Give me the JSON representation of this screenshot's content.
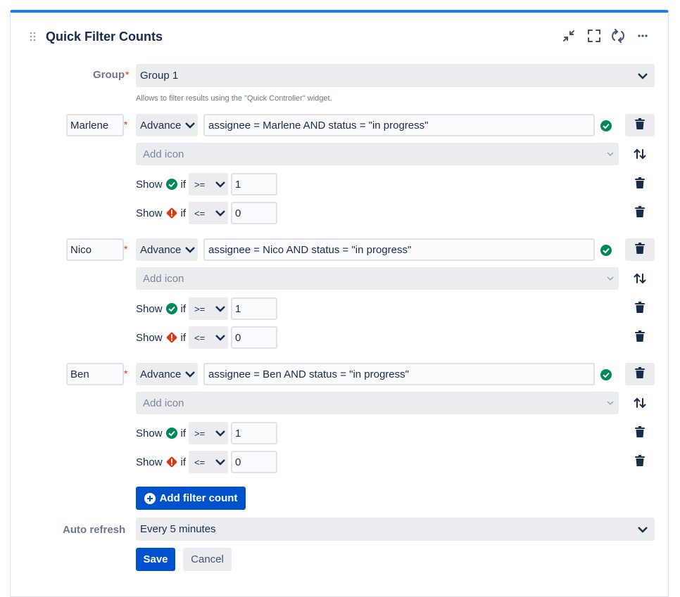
{
  "widget": {
    "title": "Quick Filter Counts"
  },
  "group": {
    "label": "Group",
    "required_mark": "*",
    "value": "Group 1",
    "help": "Allows to filter results using the \"Quick Controller\" widget."
  },
  "filters": [
    {
      "name": "Marlene",
      "mode": "Advance",
      "jql": "assignee = Marlene  AND status = \"in progress\"",
      "icon_placeholder": "Add icon",
      "rules": [
        {
          "show": "Show",
          "if": "if",
          "icon": "success-icon",
          "operator": ">=",
          "value": "1"
        },
        {
          "show": "Show",
          "if": "if",
          "icon": "error-icon",
          "operator": "<=",
          "value": "0"
        }
      ]
    },
    {
      "name": "Nico",
      "mode": "Advance",
      "jql": "assignee = Nico AND status = \"in progress\"",
      "icon_placeholder": "Add icon",
      "rules": [
        {
          "show": "Show",
          "if": "if",
          "icon": "success-icon",
          "operator": ">=",
          "value": "1"
        },
        {
          "show": "Show",
          "if": "if",
          "icon": "error-icon",
          "operator": "<=",
          "value": "0"
        }
      ]
    },
    {
      "name": "Ben",
      "mode": "Advance",
      "jql": "assignee = Ben AND status = \"in progress\"",
      "icon_placeholder": "Add icon",
      "rules": [
        {
          "show": "Show",
          "if": "if",
          "icon": "success-icon",
          "operator": ">=",
          "value": "1"
        },
        {
          "show": "Show",
          "if": "if",
          "icon": "error-icon",
          "operator": "<=",
          "value": "0"
        }
      ]
    }
  ],
  "add_filter_label": "Add filter count",
  "auto_refresh": {
    "label": "Auto refresh",
    "value": "Every 5 minutes"
  },
  "actions": {
    "save": "Save",
    "cancel": "Cancel"
  },
  "colors": {
    "accent": "#0052CC",
    "success": "#00875A",
    "error": "#DE350B",
    "top_border": "#1E7CE6"
  }
}
